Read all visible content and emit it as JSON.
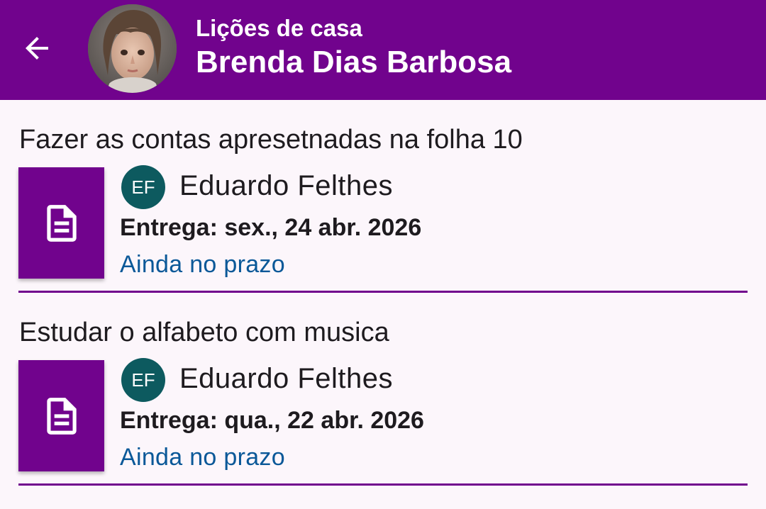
{
  "appbar": {
    "subtitle": "Lições de casa",
    "title": "Brenda Dias Barbosa",
    "back_icon": "arrow-back-icon",
    "avatar": "student-avatar-photo",
    "background_color": "#71038d"
  },
  "homework": [
    {
      "title": "Fazer as contas apresetnadas na folha 10",
      "icon": "document-icon",
      "teacher_initials": "EF",
      "teacher_name": "Eduardo Felthes",
      "due": "Entrega: sex., 24 abr. 2026",
      "status": "Ainda no prazo"
    },
    {
      "title": "Estudar o alfabeto com musica",
      "icon": "document-icon",
      "teacher_initials": "EF",
      "teacher_name": "Eduardo Felthes",
      "due": "Entrega: qua., 22 abr. 2026",
      "status": "Ainda no prazo"
    }
  ],
  "colors": {
    "accent": "#71038d",
    "teacher_avatar": "#0d5a5f",
    "status_text": "#0a5898",
    "background": "#fcf6fb"
  }
}
